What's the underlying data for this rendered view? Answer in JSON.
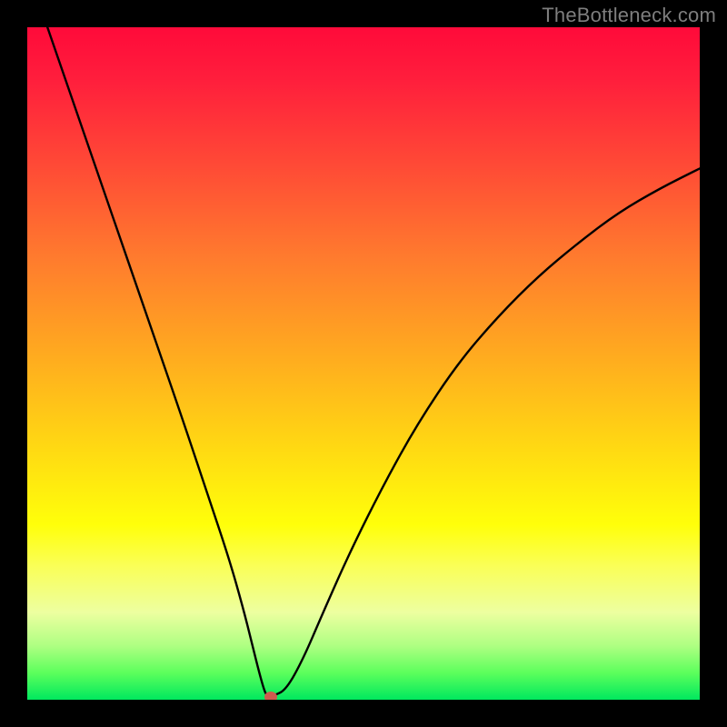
{
  "watermark": "TheBottleneck.com",
  "chart_data": {
    "type": "line",
    "title": "",
    "xlabel": "",
    "ylabel": "",
    "xlim": [
      0,
      100
    ],
    "ylim": [
      0,
      100
    ],
    "grid": false,
    "legend": false,
    "series": [
      {
        "name": "curve",
        "x": [
          3,
          8,
          13,
          18,
          23,
          27,
          30,
          32,
          33.5,
          34.5,
          35.2,
          35.6,
          36.7,
          38.5,
          41,
          44,
          48,
          53,
          58,
          64,
          70,
          76,
          82,
          88,
          94,
          100
        ],
        "values": [
          100,
          85.5,
          71,
          56.5,
          42,
          30,
          21,
          14,
          8,
          4,
          1.5,
          0.6,
          0.6,
          1.5,
          6,
          13,
          22,
          32,
          41,
          50,
          57,
          63,
          68,
          72.5,
          76,
          79
        ]
      }
    ],
    "marker": {
      "x": 36.2,
      "y": 0.4,
      "color": "#cf5a4e"
    },
    "background_gradient": {
      "type": "vertical",
      "stops": [
        {
          "pos": 0,
          "color": "#ff0a3a"
        },
        {
          "pos": 20,
          "color": "#ff4836"
        },
        {
          "pos": 48,
          "color": "#ffa820"
        },
        {
          "pos": 74,
          "color": "#ffff0a"
        },
        {
          "pos": 92,
          "color": "#aeff82"
        },
        {
          "pos": 100,
          "color": "#00e85e"
        }
      ]
    }
  }
}
